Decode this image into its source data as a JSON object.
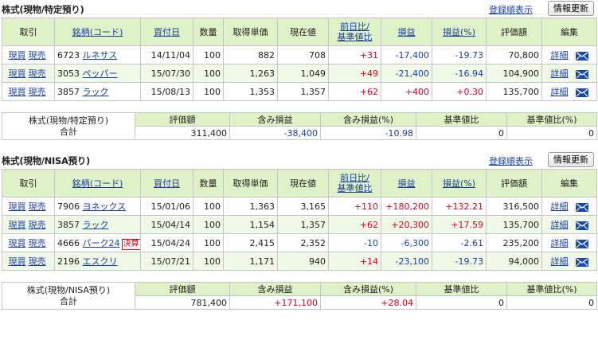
{
  "sections": [
    {
      "title": "株式(現物/特定預り)",
      "order_link": "登録順表示",
      "refresh": "情報更新",
      "headers": {
        "trade": "取引",
        "name": "銘柄(コード)",
        "date": "買付日",
        "qty": "数量",
        "cost": "取得単価",
        "price": "現在値",
        "daychg1": "前日比/",
        "daychg2": "基準値比",
        "pl": "損益",
        "plpct": "損益(%)",
        "value": "評価額",
        "edit": "編集"
      },
      "rows": [
        {
          "buy": "現買",
          "sell": "現売",
          "code": "6723",
          "name": "ルネサス",
          "date": "14/11/04",
          "qty": "100",
          "cost": "882",
          "price": "708",
          "chg": "+31",
          "pl": "-17,400",
          "plpct": "-19.73",
          "value": "70,800",
          "detail": "詳細"
        },
        {
          "buy": "現買",
          "sell": "現売",
          "code": "3053",
          "name": "ペッパー",
          "date": "15/07/30",
          "qty": "100",
          "cost": "1,263",
          "price": "1,049",
          "chg": "+49",
          "pl": "-21,400",
          "plpct": "-16.94",
          "value": "104,900",
          "detail": "詳細"
        },
        {
          "buy": "現買",
          "sell": "現売",
          "code": "3857",
          "name": "ラック",
          "date": "15/08/13",
          "qty": "100",
          "cost": "1,353",
          "price": "1,357",
          "chg": "+62",
          "pl": "+400",
          "plpct": "+0.30",
          "value": "135,700",
          "detail": "詳細"
        }
      ],
      "summary": {
        "label1": "株式(現物/特定預り)",
        "label2": "合計",
        "h_value": "評価額",
        "h_pl": "含み損益",
        "h_plpct": "含み損益(%)",
        "h_base": "基準値比",
        "h_basepct": "基準値比(%)",
        "value": "311,400",
        "pl": "-38,400",
        "plpct": "-10.98",
        "base": "0",
        "basepct": "0"
      }
    },
    {
      "title": "株式(現物/NISA預り)",
      "order_link": "登録順表示",
      "refresh": "情報更新",
      "headers": {
        "trade": "取引",
        "name": "銘柄(コード)",
        "date": "買付日",
        "qty": "数量",
        "cost": "取得単価",
        "price": "現在値",
        "daychg1": "前日比/",
        "daychg2": "基準値比",
        "pl": "損益",
        "plpct": "損益(%)",
        "value": "評価額",
        "edit": "編集"
      },
      "rows": [
        {
          "buy": "現買",
          "sell": "現売",
          "code": "7906",
          "name": "ヨネックス",
          "date": "15/01/06",
          "qty": "100",
          "cost": "1,363",
          "price": "3,165",
          "chg": "+110",
          "pl": "+180,200",
          "plpct": "+132.21",
          "value": "316,500",
          "detail": "詳細"
        },
        {
          "buy": "現買",
          "sell": "現売",
          "code": "3857",
          "name": "ラック",
          "date": "15/04/14",
          "qty": "100",
          "cost": "1,154",
          "price": "1,357",
          "chg": "+62",
          "pl": "+20,300",
          "plpct": "+17.59",
          "value": "135,700",
          "detail": "詳細"
        },
        {
          "buy": "現買",
          "sell": "現売",
          "code": "4666",
          "name": "パーク24",
          "badge": "決算",
          "date": "15/04/24",
          "qty": "100",
          "cost": "2,415",
          "price": "2,352",
          "chg": "-10",
          "pl": "-6,300",
          "plpct": "-2.61",
          "value": "235,200",
          "detail": "詳細"
        },
        {
          "buy": "現買",
          "sell": "現売",
          "code": "2196",
          "name": "エスクリ",
          "date": "15/07/21",
          "qty": "100",
          "cost": "1,171",
          "price": "940",
          "chg": "+14",
          "pl": "-23,100",
          "plpct": "-19.73",
          "value": "94,000",
          "detail": "詳細"
        }
      ],
      "summary": {
        "label1": "株式(現物/NISA預り)",
        "label2": "合計",
        "h_value": "評価額",
        "h_pl": "含み損益",
        "h_plpct": "含み損益(%)",
        "h_base": "基準値比",
        "h_basepct": "基準値比(%)",
        "value": "781,400",
        "pl": "+171,100",
        "plpct": "+28.04",
        "base": "0",
        "basepct": "0"
      }
    }
  ]
}
